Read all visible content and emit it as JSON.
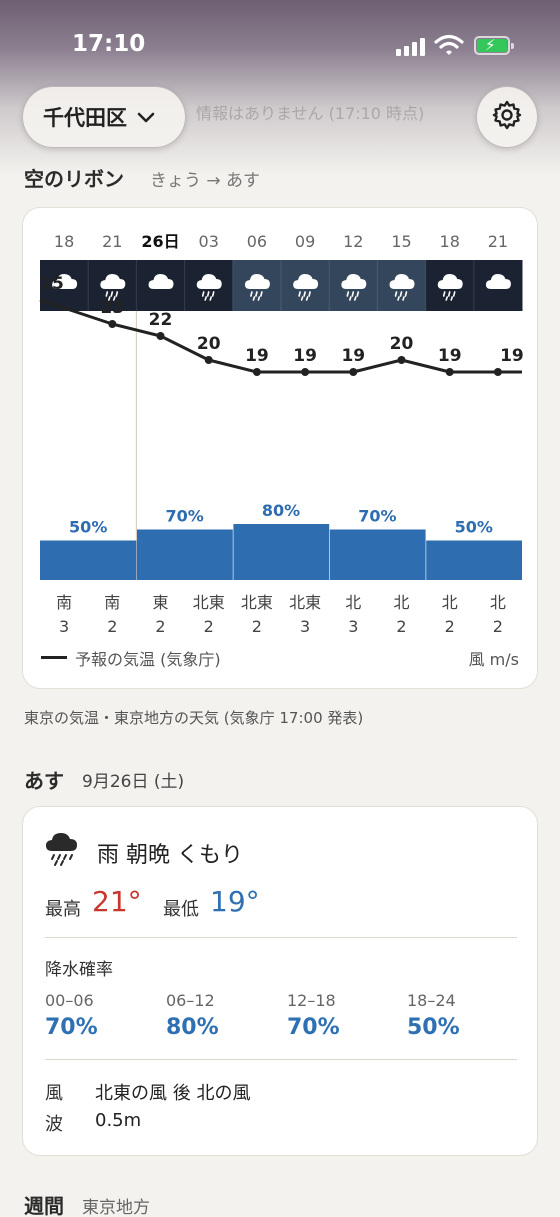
{
  "status_bar": {
    "time": "17:10"
  },
  "header": {
    "location": "千代田区",
    "notice": "情報はありません (17:10 時点)"
  },
  "ribbon_section": {
    "title": "空のリボン",
    "subtitle": "きょう → あす"
  },
  "ribbon": {
    "hours": [
      "18",
      "21",
      "26日",
      "03",
      "06",
      "09",
      "12",
      "15",
      "18",
      "21"
    ],
    "weather_icons": [
      "cloud-icon",
      "rain-cloud-icon",
      "cloud-icon",
      "rain-cloud-icon",
      "rain-cloud-icon",
      "rain-cloud-icon",
      "rain-cloud-icon",
      "rain-cloud-icon",
      "rain-cloud-icon",
      "cloud-icon"
    ],
    "sky_shades": [
      "#1b2332",
      "#1b2332",
      "#1b2332",
      "#1b2332",
      "#34465c",
      "#34465c",
      "#34465c",
      "#34465c",
      "#1b2332",
      "#1b2332"
    ],
    "wind_dir": [
      "南",
      "南",
      "東",
      "北東",
      "北東",
      "北東",
      "北",
      "北",
      "北",
      "北"
    ],
    "wind_speed": [
      "3",
      "2",
      "2",
      "2",
      "2",
      "3",
      "3",
      "2",
      "2",
      "2"
    ],
    "precip_blocks": [
      {
        "label": "50%",
        "value": 50
      },
      {
        "label": "70%",
        "value": 70
      },
      {
        "label": "80%",
        "value": 80
      },
      {
        "label": "70%",
        "value": 70
      },
      {
        "label": "50%",
        "value": 50
      }
    ],
    "legend_label": "予報の気温 (気象庁)",
    "wind_unit": "風 m/s",
    "colors": {
      "line": "#222222",
      "precip": "#2e6db0",
      "precip_text": "#2e6db0"
    }
  },
  "chart_data": {
    "type": "line",
    "x": [
      "18",
      "21",
      "26日",
      "03",
      "06",
      "09",
      "12",
      "15",
      "18",
      "21"
    ],
    "series": [
      {
        "values": [
          25,
          23,
          22,
          20,
          19,
          19,
          19,
          20,
          19,
          19
        ]
      }
    ],
    "bars": {
      "type": "bar",
      "categories": [
        "00–06",
        "06–12",
        "12–18",
        "18–24"
      ],
      "values": [
        70,
        80,
        70,
        50
      ]
    }
  },
  "source_note": "東京の気温・東京地方の天気 (気象庁 17:00 発表)",
  "tomorrow": {
    "title": "あす",
    "date": "9月26日 (土)",
    "weather": "雨 朝晩 くもり",
    "weather_icon": "rain-cloud-icon",
    "high_label": "最高",
    "high": "21°",
    "low_label": "最低",
    "low": "19°",
    "precip_title": "降水確率",
    "precip": [
      {
        "range": "00–06",
        "value": "70%"
      },
      {
        "range": "06–12",
        "value": "80%"
      },
      {
        "range": "12–18",
        "value": "70%"
      },
      {
        "range": "18–24",
        "value": "50%"
      }
    ],
    "wind_label": "風",
    "wind": "北東の風 後 北の風",
    "wave_label": "波",
    "wave": "0.5m",
    "colors": {
      "high": "#c8372d",
      "low": "#2e70b3"
    }
  },
  "weekly": {
    "title": "週間",
    "subtitle": "東京地方"
  }
}
